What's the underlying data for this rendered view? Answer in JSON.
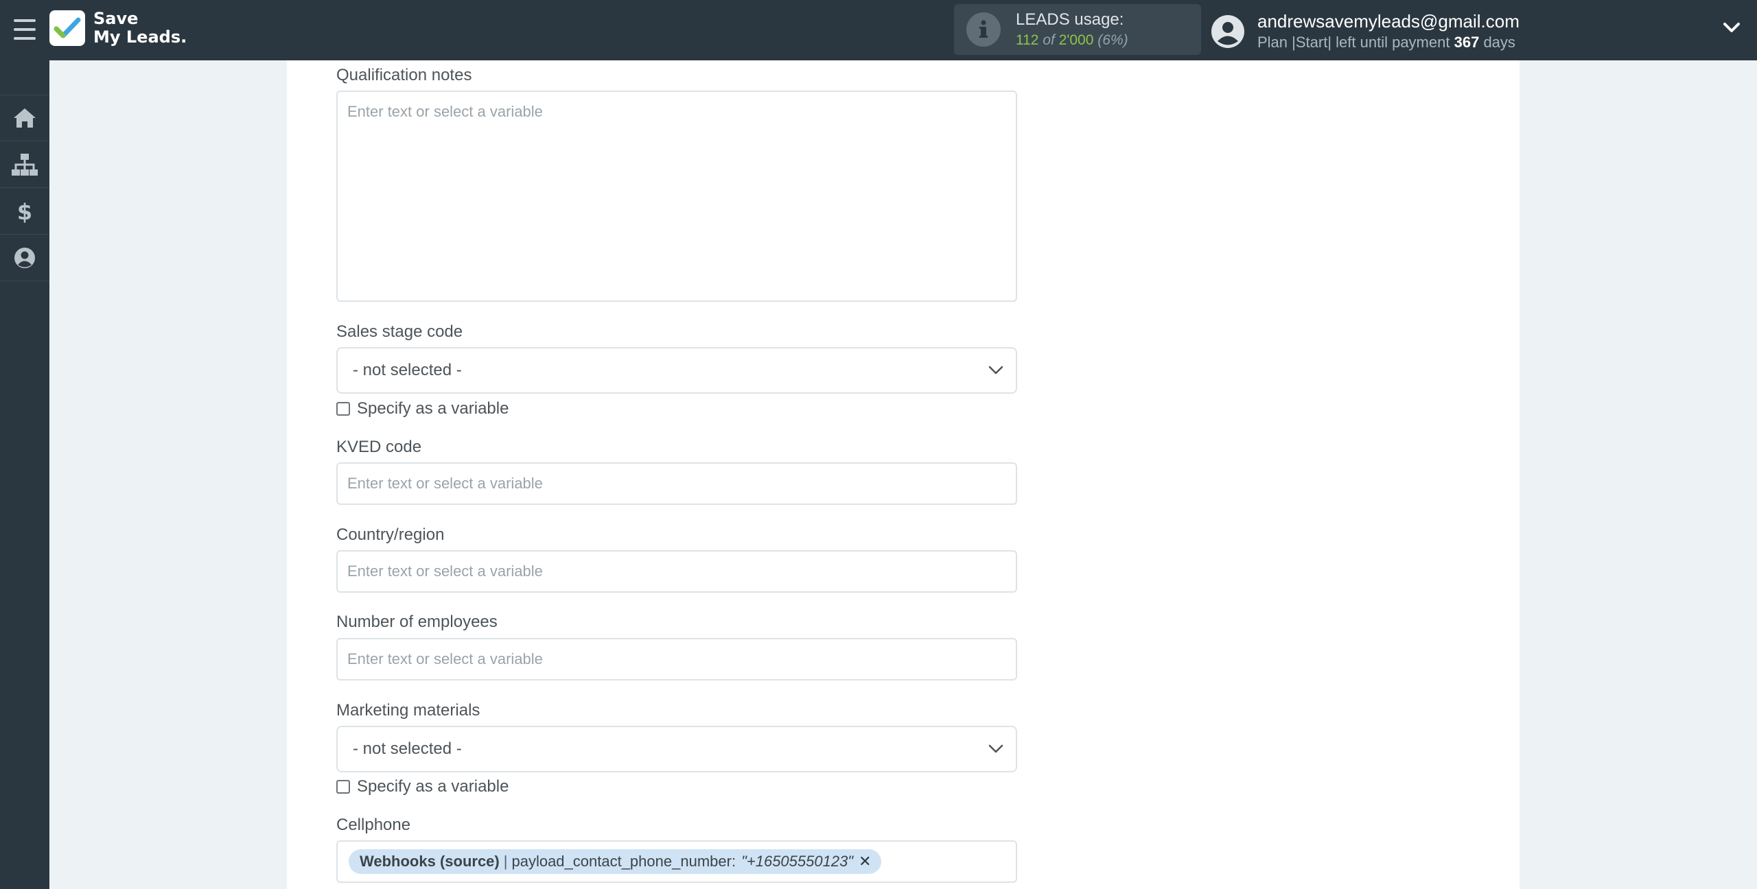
{
  "app": {
    "logo_line1": "Save",
    "logo_line2": "My Leads",
    "logo_dot": "."
  },
  "usage": {
    "title": "LEADS usage:",
    "used": "112",
    "of": "of",
    "total": "2'000",
    "percent": "(6%)"
  },
  "account": {
    "email": "andrewsavemyleads@gmail.com",
    "plan_prefix": "Plan |Start| left until payment",
    "days_value": "367",
    "days_suffix": "days"
  },
  "sidebar": {
    "items": [
      {
        "icon": "home-icon"
      },
      {
        "icon": "sitemap-icon"
      },
      {
        "icon": "dollar-icon"
      },
      {
        "icon": "user-circle-icon"
      }
    ]
  },
  "form": {
    "qualification_notes": {
      "label": "Qualification notes",
      "placeholder": "Enter text or select a variable"
    },
    "sales_stage_code": {
      "label": "Sales stage code",
      "value": "- not selected -",
      "checkbox_label": "Specify as a variable"
    },
    "kved_code": {
      "label": "KVED code",
      "placeholder": "Enter text or select a variable"
    },
    "country_region": {
      "label": "Country/region",
      "placeholder": "Enter text or select a variable"
    },
    "number_of_employees": {
      "label": "Number of employees",
      "placeholder": "Enter text or select a variable"
    },
    "marketing_materials": {
      "label": "Marketing materials",
      "value": "- not selected -",
      "checkbox_label": "Specify as a variable"
    },
    "cellphone": {
      "label": "Cellphone",
      "tag_source": "Webhooks (source)",
      "tag_separator": "|",
      "tag_field": "payload_contact_phone_number:",
      "tag_value": "\"+16505550123\"",
      "tag_remove": "✕"
    }
  },
  "colors": {
    "topbar": "#2b3740",
    "accent_green": "#8ec34a",
    "tag_bg": "#cfe3f5",
    "page_bg": "#edf2f4"
  }
}
